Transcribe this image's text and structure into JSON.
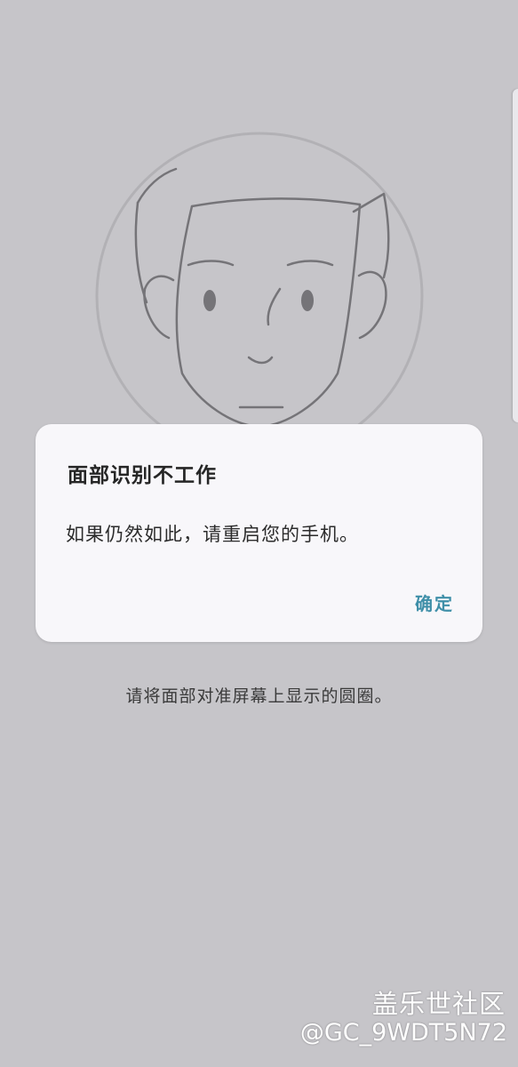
{
  "dialog": {
    "title": "面部识别不工作",
    "message": "如果仍然如此，请重启您的手机。",
    "confirm_label": "确定"
  },
  "hint": "请将面部对准屏幕上显示的圆圈。",
  "watermark": {
    "site": "盖乐世社区",
    "user": "@GC_9WDT5N72"
  },
  "colors": {
    "background": "#c6c5c9",
    "dialog_background": "#f8f7fa",
    "accent": "#3f8fa8"
  },
  "icons": {
    "face": "face-outline-icon",
    "circle": "face-guide-circle-icon"
  }
}
